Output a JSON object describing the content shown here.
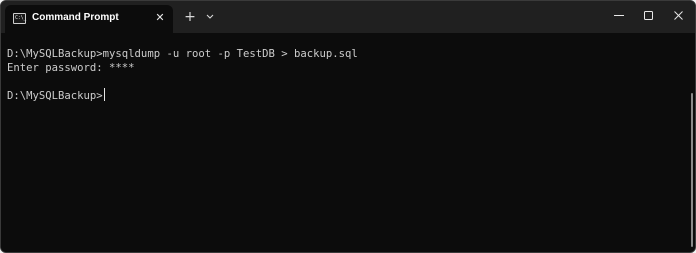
{
  "window": {
    "tab_title": "Command Prompt",
    "tab_icon_text": "C:\\_",
    "new_tab_symbol": "+",
    "close_tab_symbol": "✕"
  },
  "terminal": {
    "lines": [
      "D:\\MySQLBackup>mysqldump -u root -p TestDB > backup.sql",
      "Enter password: ****"
    ],
    "prompt": "D:\\MySQLBackup>"
  },
  "colors": {
    "background": "#0c0c0c",
    "titlebar": "#202020",
    "text": "#cccccc"
  }
}
